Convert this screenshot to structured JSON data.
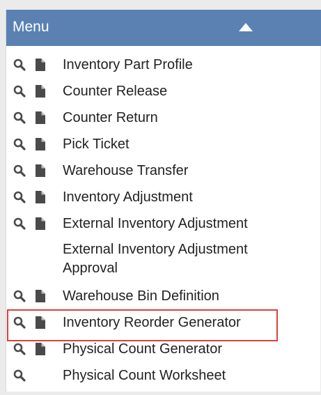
{
  "menu": {
    "title": "Menu",
    "collapse_icon": "caret-up-icon",
    "accent_color": "#5a81b2",
    "highlight_color": "#d9423d",
    "items": [
      {
        "label": "Inventory Part Profile",
        "search": true,
        "doc": true
      },
      {
        "label": "Counter Release",
        "search": true,
        "doc": true
      },
      {
        "label": "Counter Return",
        "search": true,
        "doc": true
      },
      {
        "label": "Pick Ticket",
        "search": true,
        "doc": true
      },
      {
        "label": "Warehouse Transfer",
        "search": true,
        "doc": true
      },
      {
        "label": "Inventory Adjustment",
        "search": true,
        "doc": true
      },
      {
        "label": "External Inventory Adjustment",
        "search": true,
        "doc": true
      },
      {
        "label": "External Inventory Adjustment Approval",
        "search": false,
        "doc": false
      },
      {
        "label": "Warehouse Bin Definition",
        "search": true,
        "doc": true
      },
      {
        "label": "Inventory Reorder Generator",
        "search": true,
        "doc": true,
        "highlighted": true
      },
      {
        "label": "Physical Count Generator",
        "search": true,
        "doc": true
      },
      {
        "label": "Physical Count Worksheet",
        "search": true,
        "doc": false
      }
    ]
  }
}
